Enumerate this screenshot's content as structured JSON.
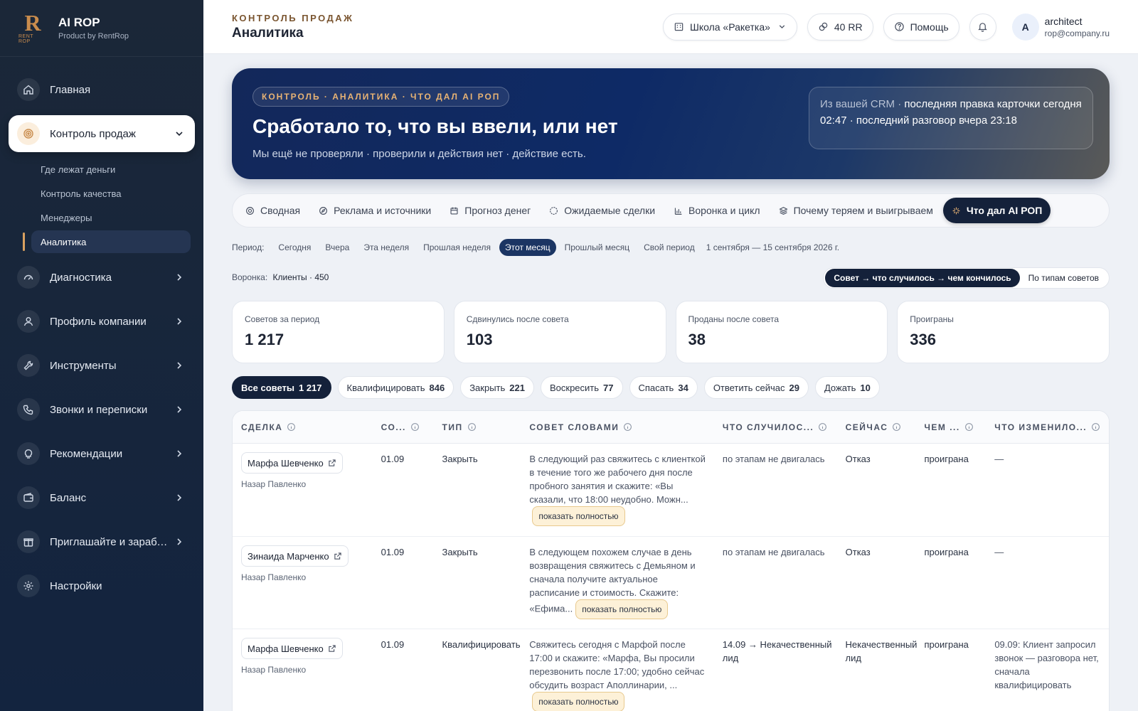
{
  "brand": {
    "logo_text": "R",
    "logo_sub": "RENT ROP",
    "title": "AI ROP",
    "subtitle": "Product by RentRop"
  },
  "sidebar": {
    "items": [
      {
        "label": "Главная",
        "icon": "home-icon"
      },
      {
        "label": "Контроль продаж",
        "icon": "target-icon",
        "active": true
      },
      {
        "label": "Диагностика",
        "icon": "gauge-icon"
      },
      {
        "label": "Профиль компании",
        "icon": "user-icon"
      },
      {
        "label": "Инструменты",
        "icon": "wrench-icon"
      },
      {
        "label": "Звонки и переписки",
        "icon": "phone-icon"
      },
      {
        "label": "Рекомендации",
        "icon": "lightbulb-icon"
      },
      {
        "label": "Баланс",
        "icon": "wallet-icon"
      },
      {
        "label": "Приглашайте и зарабатывайте",
        "icon": "gift-icon"
      },
      {
        "label": "Настройки",
        "icon": "gear-icon"
      }
    ],
    "subitems": [
      {
        "label": "Где лежат деньги"
      },
      {
        "label": "Контроль качества"
      },
      {
        "label": "Менеджеры"
      },
      {
        "label": "Аналитика",
        "active": true
      }
    ]
  },
  "header": {
    "crumb": "КОНТРОЛЬ ПРОДАЖ",
    "title": "Аналитика",
    "school": "Школа «Ракетка»",
    "balance": "40 RR",
    "help": "Помощь",
    "user_initial": "A",
    "user_name": "architect",
    "user_email": "rop@company.ru"
  },
  "hero": {
    "tag": "КОНТРОЛЬ · АНАЛИТИКА · ЧТО ДАЛ AI РОП",
    "title": "Сработало то, что вы ввели, или нет",
    "subtitle": "Мы ещё не проверяли · проверили и действия нет · действие есть.",
    "crm_prefix": "Из вашей CRM ·",
    "crm_line1": "последняя правка карточки сегодня",
    "crm_line2": "02:47 · последний разговор вчера 23:18"
  },
  "tabs": [
    {
      "label": "Сводная",
      "icon": "circle-target-icon"
    },
    {
      "label": "Реклама и источники",
      "icon": "compass-icon"
    },
    {
      "label": "Прогноз денег",
      "icon": "calendar-icon"
    },
    {
      "label": "Ожидаемые сделки",
      "icon": "dashed-circle-icon"
    },
    {
      "label": "Воронка и цикл",
      "icon": "bar-chart-icon"
    },
    {
      "label": "Почему теряем и выигрываем",
      "icon": "layers-icon"
    },
    {
      "label": "Что дал AI РОП",
      "icon": "sparkle-icon",
      "active": true
    }
  ],
  "period": {
    "label": "Период:",
    "options": [
      "Сегодня",
      "Вчера",
      "Эта неделя",
      "Прошлая неделя",
      "Этот месяц",
      "Прошлый месяц",
      "Свой период"
    ],
    "active_index": 4,
    "range": "1 сентября — 15 сентября 2026 г."
  },
  "funnel": {
    "label": "Воронка:",
    "value": "Клиенты · 450"
  },
  "view_toggle": {
    "options": [
      "Совет → что случилось → чем кончилось",
      "По типам советов"
    ],
    "active_index": 0
  },
  "stats": [
    {
      "label": "Советов за период",
      "value": "1 217"
    },
    {
      "label": "Сдвинулись после совета",
      "value": "103"
    },
    {
      "label": "Проданы после совета",
      "value": "38"
    },
    {
      "label": "Проиграны",
      "value": "336"
    }
  ],
  "filters": [
    {
      "label": "Все советы",
      "count": "1 217",
      "active": true
    },
    {
      "label": "Квалифицировать",
      "count": "846"
    },
    {
      "label": "Закрыть",
      "count": "221"
    },
    {
      "label": "Воскресить",
      "count": "77"
    },
    {
      "label": "Спасать",
      "count": "34"
    },
    {
      "label": "Ответить сейчас",
      "count": "29"
    },
    {
      "label": "Дожать",
      "count": "10"
    }
  ],
  "table": {
    "columns": [
      "СДЕЛКА",
      "СО...",
      "ТИП",
      "СОВЕТ СЛОВАМИ",
      "ЧТО СЛУЧИЛОС...",
      "СЕЙЧАС",
      "ЧЕМ ...",
      "ЧТО ИЗМЕНИЛО..."
    ],
    "show_more_label": "показать полностью",
    "rows": [
      {
        "deal": "Марфа Шевченко",
        "manager": "Назар Павленко",
        "date": "01.09",
        "type": "Закрыть",
        "advice": "В следующий раз свяжитесь с клиенткой в течение того же рабочего дня после пробного занятия и скажите: «Вы сказали, что 18:00 неудобно. Можн...",
        "happened": "по этапам не двигалась",
        "now": "Отказ",
        "result": "проиграна",
        "changed": "—"
      },
      {
        "deal": "Зинаида Марченко",
        "manager": "Назар Павленко",
        "date": "01.09",
        "type": "Закрыть",
        "advice": "В следующем похожем случае в день возвращения свяжитесь с Демьяном и сначала получите актуальное расписание и стоимость. Скажите: «Ефима...",
        "happened": "по этапам не двигалась",
        "now": "Отказ",
        "result": "проиграна",
        "changed": "—"
      },
      {
        "deal": "Марфа Шевченко",
        "manager": "Назар Павленко",
        "date": "01.09",
        "type": "Квалифицировать",
        "advice": "Свяжитесь сегодня с Марфой после 17:00 и скажите: «Марфа, Вы просили перезвонить после 17:00; удобно сейчас обсудить возраст Аполлинарии, ...",
        "happened": "14.09 → Некачественный лид",
        "now": "Некачественный лид",
        "result": "проиграна",
        "changed": "09.09: Клиент запросил звонок — разговора нет, сначала квалифицировать"
      }
    ]
  },
  "colors": {
    "sidebar_bg": "#1b2738",
    "accent_gold": "#d9a160",
    "active_dark": "#14213a",
    "hero_blue": "#0e2a66",
    "show_more_bg": "#fdf1d8"
  }
}
